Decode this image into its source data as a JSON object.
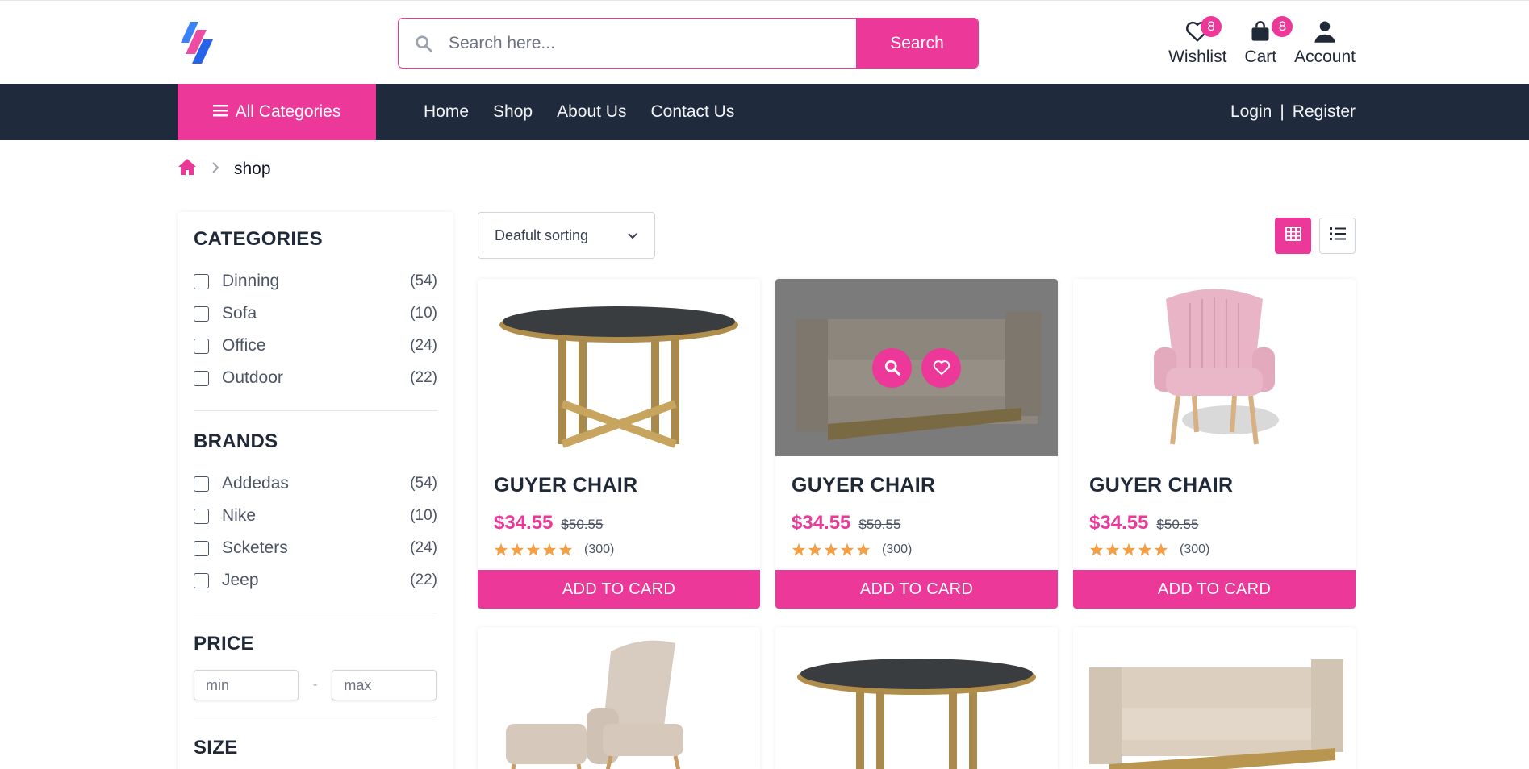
{
  "header": {
    "search_placeholder": "Search here...",
    "search_button": "Search",
    "wishlist": {
      "label": "Wishlist",
      "count": "8"
    },
    "cart": {
      "label": "Cart",
      "count": "8"
    },
    "account": {
      "label": "Account"
    }
  },
  "nav": {
    "all_categories": "All Categories",
    "links": [
      "Home",
      "Shop",
      "About Us",
      "Contact Us"
    ],
    "login": "Login",
    "separator": "|",
    "register": "Register"
  },
  "breadcrumb": {
    "current": "shop"
  },
  "sidebar": {
    "categories_title": "CATEGORIES",
    "categories": [
      {
        "name": "Dinning",
        "count": "(54)"
      },
      {
        "name": "Sofa",
        "count": "(10)"
      },
      {
        "name": "Office",
        "count": "(24)"
      },
      {
        "name": "Outdoor",
        "count": "(22)"
      }
    ],
    "brands_title": "BRANDS",
    "brands": [
      {
        "name": "Addedas",
        "count": "(54)"
      },
      {
        "name": "Nike",
        "count": "(10)"
      },
      {
        "name": "Scketers",
        "count": "(24)"
      },
      {
        "name": "Jeep",
        "count": "(22)"
      }
    ],
    "price_title": "PRICE",
    "price_min_placeholder": "min",
    "price_separator": "-",
    "price_max_placeholder": "max",
    "size_title": "SIZE"
  },
  "toolbar": {
    "sort_label": "Deafult sorting"
  },
  "products": [
    {
      "title": "GUYER CHAIR",
      "price": "$34.55",
      "old_price": "$50.55",
      "rating_count": "(300)",
      "button": "ADD TO CARD"
    },
    {
      "title": "GUYER CHAIR",
      "price": "$34.55",
      "old_price": "$50.55",
      "rating_count": "(300)",
      "button": "ADD TO CARD"
    },
    {
      "title": "GUYER CHAIR",
      "price": "$34.55",
      "old_price": "$50.55",
      "rating_count": "(300)",
      "button": "ADD TO CARD"
    }
  ],
  "colors": {
    "accent": "#ec3899",
    "nav_bg": "#1f2a3c",
    "star": "#f59e42"
  },
  "icons": [
    "search-icon",
    "heart-icon",
    "bag-icon",
    "user-icon",
    "bars-icon",
    "home-icon",
    "chevron-right-icon",
    "chevron-down-icon",
    "grid-icon",
    "list-icon",
    "star-icon"
  ]
}
